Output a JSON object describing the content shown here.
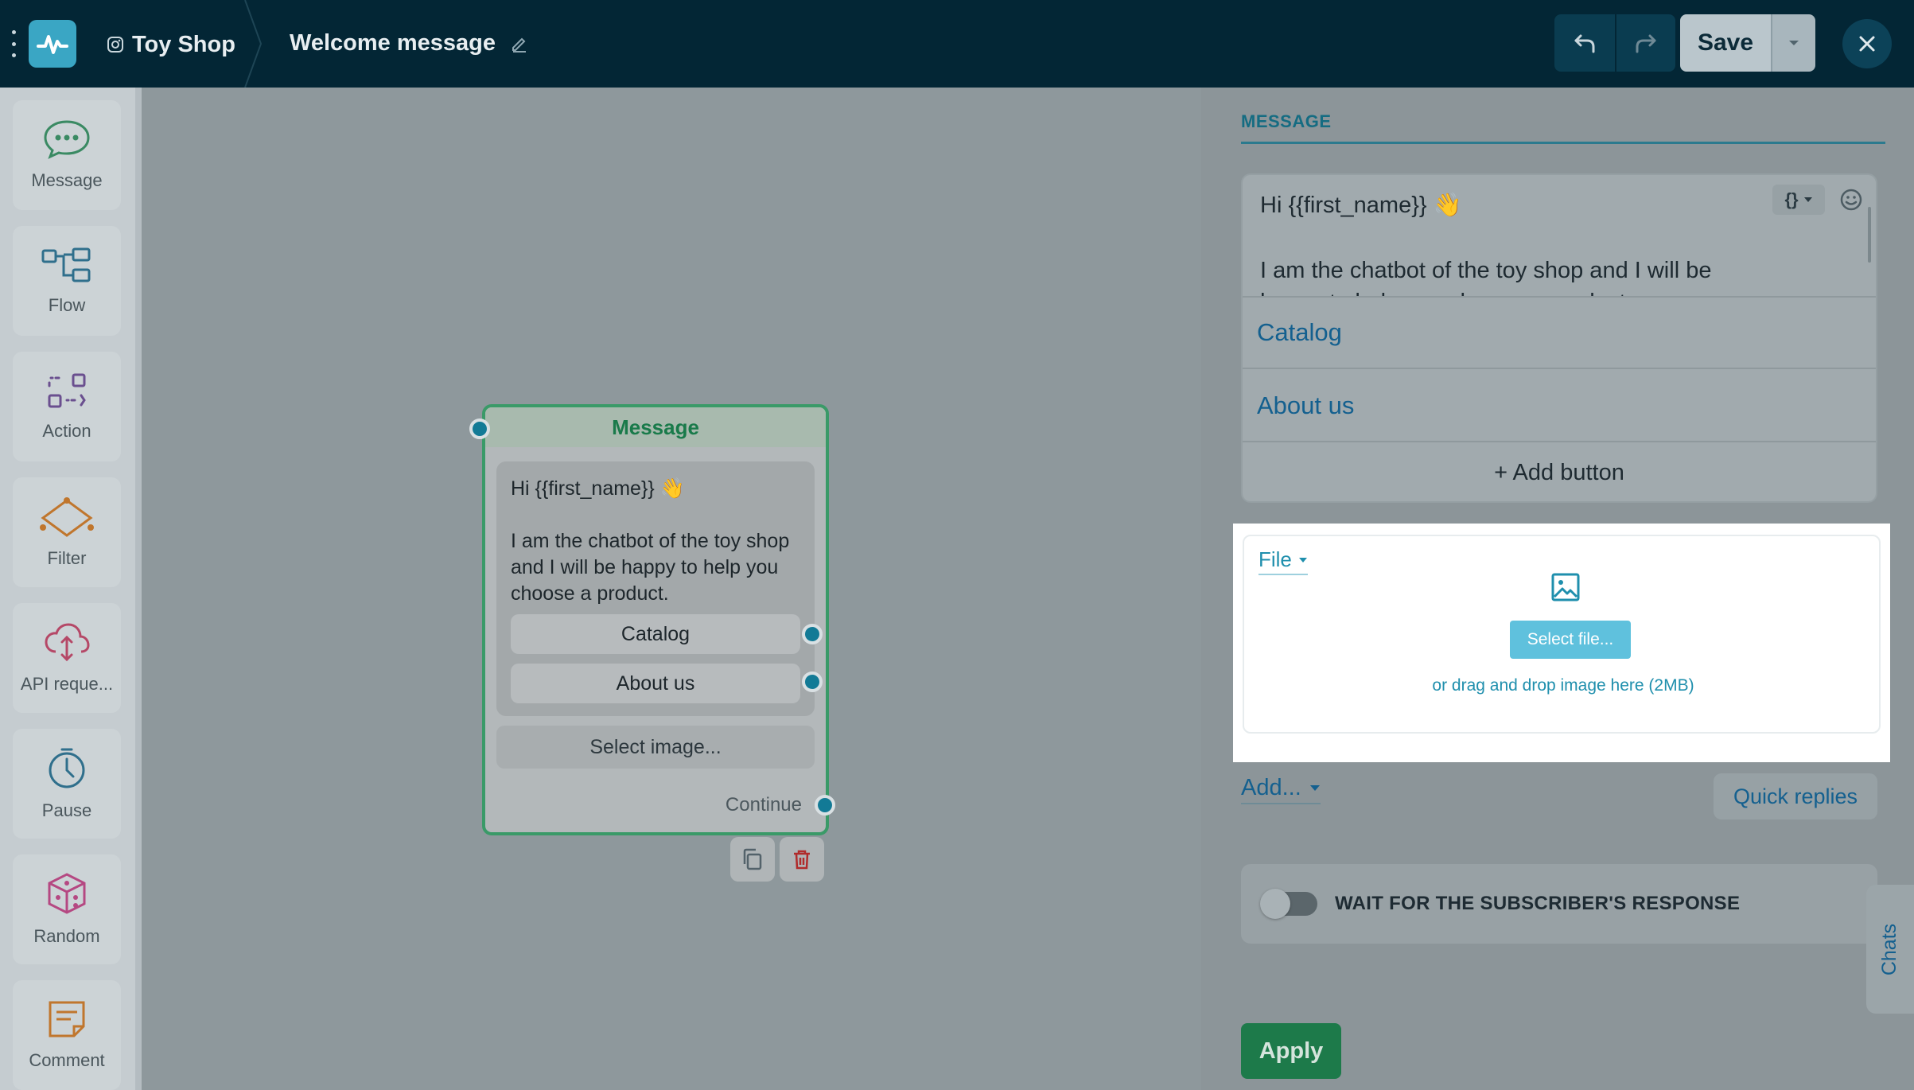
{
  "header": {
    "project_name": "Toy Shop",
    "flow_title": "Welcome message",
    "save_label": "Save"
  },
  "palette": {
    "items": [
      {
        "label": "Message",
        "icon": "chat-bubble-icon"
      },
      {
        "label": "Flow",
        "icon": "flow-icon"
      },
      {
        "label": "Action",
        "icon": "action-icon"
      },
      {
        "label": "Filter",
        "icon": "filter-icon"
      },
      {
        "label": "API reque...",
        "icon": "api-cloud-icon"
      },
      {
        "label": "Pause",
        "icon": "clock-icon"
      },
      {
        "label": "Random",
        "icon": "dice-icon"
      },
      {
        "label": "Comment",
        "icon": "comment-icon"
      }
    ]
  },
  "node": {
    "title": "Message",
    "text_line1": "Hi {{first_name}} 👋",
    "text_line2": "I am the chatbot of the toy shop and I will be happy to help you choose a product.",
    "buttons": [
      "Catalog",
      "About us"
    ],
    "select_image": "Select image...",
    "continue_label": "Continue"
  },
  "panel": {
    "section_title": "MESSAGE",
    "editor_line1": "Hi {{first_name}} 👋",
    "editor_line2": "I am the chatbot of the toy shop and I will be",
    "editor_line3": "happy to help you choose a product.",
    "variable_label": "{}",
    "buttons": [
      "Catalog",
      "About us"
    ],
    "add_button": "+ Add button",
    "file_type": "File",
    "select_file": "Select file...",
    "drag_hint": "or drag and drop image here (2MB)",
    "add_menu": "Add...",
    "quick_replies": "Quick replies",
    "wait_label": "WAIT FOR THE SUBSCRIBER'S RESPONSE",
    "chats_tab": "Chats",
    "apply_label": "Apply"
  },
  "colors": {
    "topbar": "#032635",
    "accent": "#1f8fad",
    "node_border": "#3a9a68",
    "apply": "#1d7a4a"
  }
}
